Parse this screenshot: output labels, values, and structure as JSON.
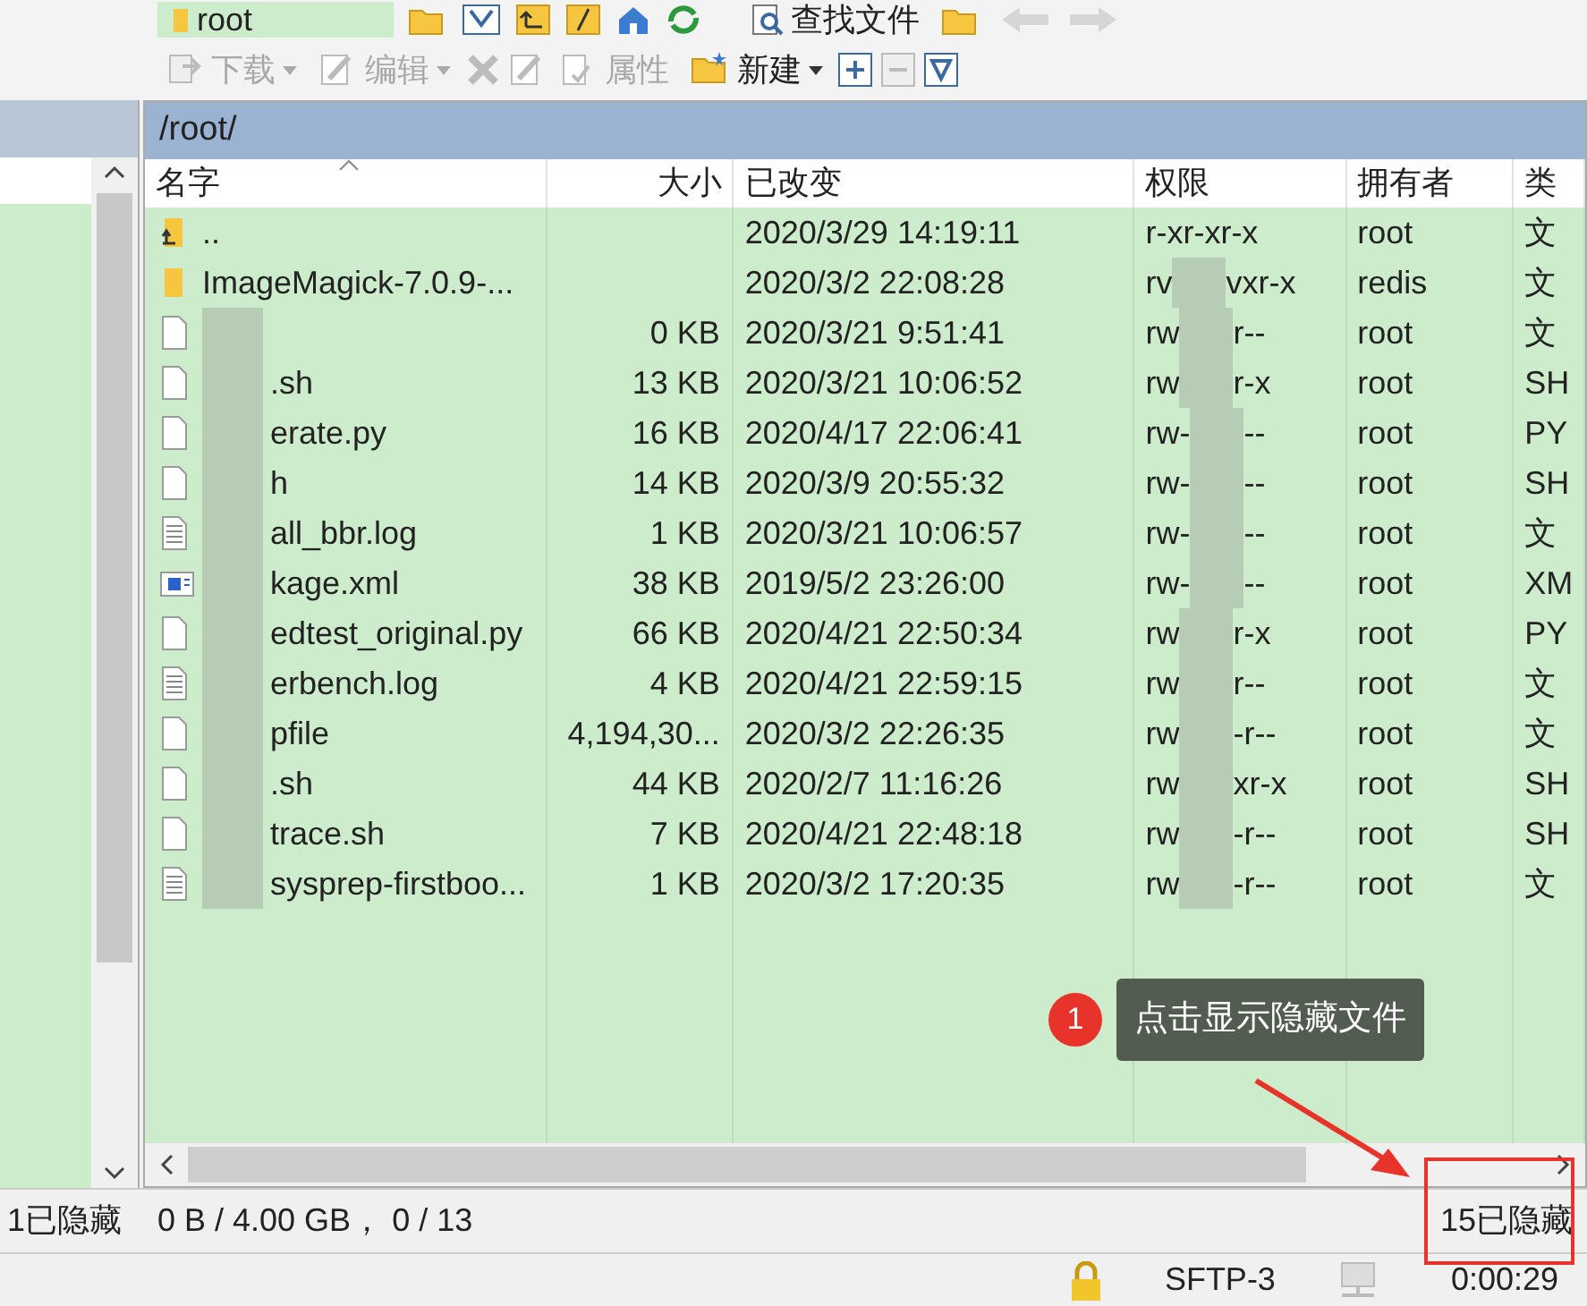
{
  "toolbar_top": {
    "location": "root",
    "find_button": "查找文件"
  },
  "toolbar_actions": [
    {
      "label": "下载",
      "disabled": true,
      "dropdown": true
    },
    {
      "label": "编辑",
      "disabled": true,
      "dropdown": true
    },
    {
      "label": "属性",
      "disabled": true,
      "dropdown": false
    },
    {
      "label": "新建",
      "disabled": false,
      "dropdown": true
    }
  ],
  "path": "/root/",
  "columns": [
    "名字",
    "大小",
    "已改变",
    "权限",
    "拥有者",
    "类"
  ],
  "rows": [
    {
      "kind": "parent",
      "name": "..",
      "size": "",
      "changed": "2020/3/29 14:19:11",
      "perm_start": "r-xr-xr-x",
      "perm_end": "",
      "owner": "root",
      "type": "文",
      "blurred": false
    },
    {
      "kind": "folder",
      "name": "ImageMagick-7.0.9-...",
      "size": "",
      "changed": "2020/3/2 22:08:28",
      "perm_start": "rv",
      "perm_end": "vxr-x",
      "owner": "redis",
      "type": "文",
      "blurred": false
    },
    {
      "kind": "file",
      "name": "",
      "size": "0 KB",
      "changed": "2020/3/21 9:51:41",
      "perm_start": "rw",
      "perm_end": "r--",
      "owner": "root",
      "type": "文",
      "blurred": true
    },
    {
      "kind": "file",
      "name": ".sh",
      "size": "13 KB",
      "changed": "2020/3/21 10:06:52",
      "perm_start": "rw",
      "perm_end": "r-x",
      "owner": "root",
      "type": "SH",
      "blurred": true
    },
    {
      "kind": "file",
      "name": "erate.py",
      "size": "16 KB",
      "changed": "2020/4/17 22:06:41",
      "perm_start": "rw-",
      "perm_end": "--",
      "owner": "root",
      "type": "PY",
      "blurred": true
    },
    {
      "kind": "file",
      "name": "h",
      "size": "14 KB",
      "changed": "2020/3/9 20:55:32",
      "perm_start": "rw-",
      "perm_end": "--",
      "owner": "root",
      "type": "SH",
      "blurred": true
    },
    {
      "kind": "text",
      "name": "all_bbr.log",
      "size": "1 KB",
      "changed": "2020/3/21 10:06:57",
      "perm_start": "rw-",
      "perm_end": "--",
      "owner": "root",
      "type": "文",
      "blurred": true
    },
    {
      "kind": "xml",
      "name": "kage.xml",
      "size": "38 KB",
      "changed": "2019/5/2 23:26:00",
      "perm_start": "rw-",
      "perm_end": "--",
      "owner": "root",
      "type": "XM",
      "blurred": true
    },
    {
      "kind": "file",
      "name": "edtest_original.py",
      "size": "66 KB",
      "changed": "2020/4/21 22:50:34",
      "perm_start": "rw",
      "perm_end": "r-x",
      "owner": "root",
      "type": "PY",
      "blurred": true
    },
    {
      "kind": "text",
      "name": "erbench.log",
      "size": "4 KB",
      "changed": "2020/4/21 22:59:15",
      "perm_start": "rw",
      "perm_end": "r--",
      "owner": "root",
      "type": "文",
      "blurred": true
    },
    {
      "kind": "file",
      "name": "pfile",
      "size": "4,194,30...",
      "changed": "2020/3/2 22:26:35",
      "perm_start": "rw",
      "perm_end": "-r--",
      "owner": "root",
      "type": "文",
      "blurred": true
    },
    {
      "kind": "file",
      "name": ".sh",
      "size": "44 KB",
      "changed": "2020/2/7 11:16:26",
      "perm_start": "rw",
      "perm_end": "xr-x",
      "owner": "root",
      "type": "SH",
      "blurred": true
    },
    {
      "kind": "file",
      "name": "trace.sh",
      "size": "7 KB",
      "changed": "2020/4/21 22:48:18",
      "perm_start": "rw",
      "perm_end": "-r--",
      "owner": "root",
      "type": "SH",
      "blurred": true
    },
    {
      "kind": "text",
      "name": "sysprep-firstboo...",
      "size": "1 KB",
      "changed": "2020/3/2 17:20:35",
      "perm_start": "rw",
      "perm_end": "-r--",
      "owner": "root",
      "type": "文",
      "blurred": true
    }
  ],
  "callout": {
    "number": "1",
    "text": "点击显示隐藏文件"
  },
  "status_bar": {
    "left_hidden": "1已隐藏",
    "summary": "0 B / 4.00 GB， 0 / 13",
    "right_hidden": "15已隐藏"
  },
  "connection_bar": {
    "protocol": "SFTP-3",
    "elapsed": "0:00:29"
  }
}
